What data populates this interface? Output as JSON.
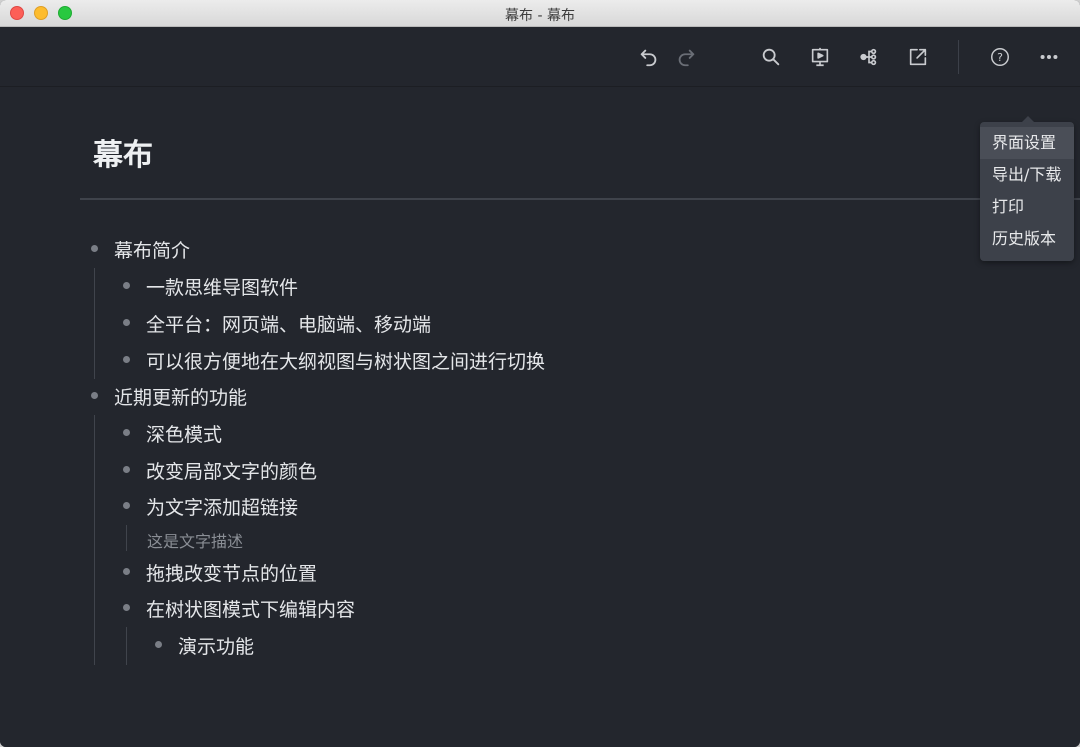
{
  "window": {
    "title": "幕布 - 幕布"
  },
  "toolbar": {
    "undo": "undo-icon",
    "redo": "redo-icon",
    "search": "search-icon",
    "present": "present-icon",
    "mindmap": "mindmap-icon",
    "share": "share-icon",
    "help": "help-icon",
    "more": "more-icon"
  },
  "menu": {
    "items": [
      {
        "label": "界面设置",
        "active": true
      },
      {
        "label": "导出/下载"
      },
      {
        "label": "打印"
      },
      {
        "label": "历史版本"
      }
    ]
  },
  "doc": {
    "title": "幕布",
    "nodes": [
      {
        "text": "幕布简介",
        "level": 0
      },
      {
        "text": "一款思维导图软件",
        "level": 1
      },
      {
        "text": "全平台：网页端、电脑端、移动端",
        "level": 1
      },
      {
        "text": "可以很方便地在大纲视图与树状图之间进行切换",
        "level": 1
      },
      {
        "text": "近期更新的功能",
        "level": 0
      },
      {
        "text": "深色模式",
        "level": 1
      },
      {
        "text": "改变局部文字的颜色",
        "level": 1
      },
      {
        "text": "为文字添加超链接",
        "level": 1,
        "note": "这是文字描述"
      },
      {
        "text": "拖拽改变节点的位置",
        "level": 1
      },
      {
        "text": "在树状图模式下编辑内容",
        "level": 1
      },
      {
        "text": "演示功能",
        "level": 2
      }
    ]
  },
  "colors": {
    "background": "#23262d",
    "text": "#e4e6e9",
    "muted": "#8a8e95"
  }
}
